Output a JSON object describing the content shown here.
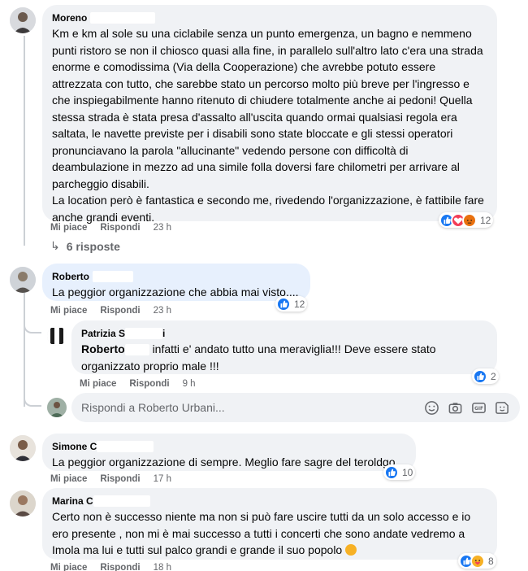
{
  "comments": [
    {
      "author": "Moreno",
      "text": "Km e km al sole su una ciclabile senza un punto emergenza, un bagno e nemmeno punti ristoro se non il chiosco quasi alla fine, in parallelo sull'altro lato c'era una strada enorme e comodissima (Via della Cooperazione) che avrebbe potuto essere attrezzata con tutto, che sarebbe stato un percorso molto più breve per l'ingresso e che inspiegabilmente hanno ritenuto di chiudere totalmente anche ai pedoni! Quella stessa strada è stata presa d'assalto all'uscita quando ormai qualsiasi regola era saltata, le navette previste per i disabili sono state bloccate e gli stessi operatori pronunciavano la parola \"allucinante\" vedendo persone con difficoltà di deambulazione in mezzo ad una simile folla doversi fare chilometri per arrivare al parcheggio disabili.",
      "text2": "La location però è fantastica e secondo me, rivedendo l'organizzazione, è fattibile fare anche grandi eventi.",
      "like": "Mi piace",
      "reply": "Rispondi",
      "time": "23 h",
      "reactions": "12",
      "replies": "6 risposte"
    },
    {
      "author": "Roberto",
      "text": "La peggior organizzazione che abbia mai visto....",
      "like": "Mi piace",
      "reply": "Rispondi",
      "time": "23 h",
      "reactions": "12"
    },
    {
      "author": "Patrizia S",
      "author_tail": "i",
      "mention": "Roberto",
      "text": "infatti e' andato tutto una meraviglia!!! Deve essere stato organizzato proprio male !!!",
      "like": "Mi piace",
      "reply": "Rispondi",
      "time": "9 h",
      "reactions": "2"
    },
    {
      "author": "Simone C",
      "text": "La peggior organizzazione di sempre. Meglio fare sagre del teroldgo.",
      "like": "Mi piace",
      "reply": "Rispondi",
      "time": "17 h",
      "reactions": "10"
    },
    {
      "author": "Marina C",
      "text": "Certo non è successo niente ma non si può fare uscire tutti da un solo accesso e io ero presente , non mi è mai successo a tutti i concerti che sono andate vedremo a Imola ma lui e tutti sul palco grandi e grande il suo popolo",
      "like": "Mi piace",
      "reply": "Rispondi",
      "time": "18 h",
      "reactions": "8"
    }
  ],
  "reply_box": {
    "placeholder": "Rispondi a Roberto Urbani..."
  },
  "colors": {
    "like_blue": "#1877f2",
    "love_red": "#f33e58",
    "angry_orange": "#e9710f",
    "haha_yellow": "#f7b125",
    "bubble_bg": "#f0f2f5",
    "meta_gray": "#65676b"
  },
  "icons": [
    "like-icon",
    "love-icon",
    "angry-icon",
    "care-icon",
    "emoji-icon",
    "camera-icon",
    "gif-icon",
    "sticker-icon",
    "reply-arrow-icon",
    "hug-emoji-icon"
  ]
}
